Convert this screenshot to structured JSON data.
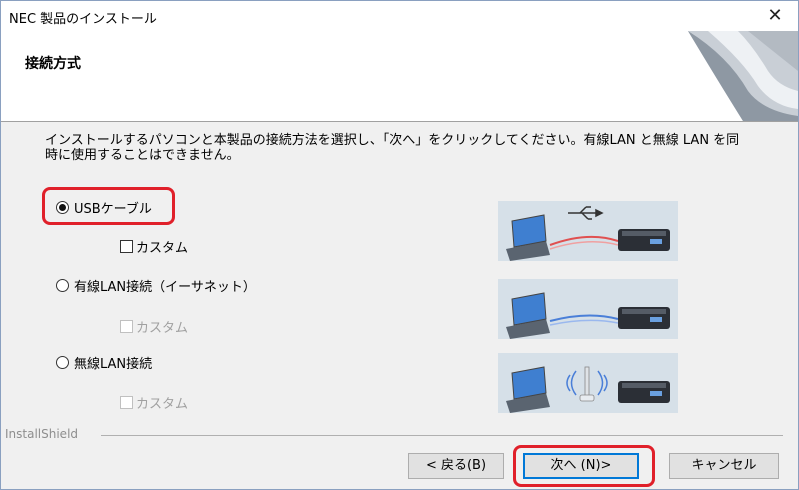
{
  "window": {
    "title": "NEC 製品のインストール",
    "close_glyph": "✕"
  },
  "header": {
    "title": "接続方式"
  },
  "instruction": "インストールするパソコンと本製品の接続方法を選択し、「次へ」をクリックしてください。有線LAN と無線 LAN を同時に使用することはできません。",
  "options": [
    {
      "label": "USBケーブル",
      "checked": true,
      "custom_label": "カスタム",
      "custom_enabled": true
    },
    {
      "label": "有線LAN接続（イーサネット）",
      "checked": false,
      "custom_label": "カスタム",
      "custom_enabled": false
    },
    {
      "label": "無線LAN接続",
      "checked": false,
      "custom_label": "カスタム",
      "custom_enabled": false
    }
  ],
  "footer": {
    "brand": "InstallShield"
  },
  "buttons": {
    "back": "< 戻る(B)",
    "next": "次へ (N)>",
    "cancel": "キャンセル"
  },
  "colors": {
    "highlight": "#e0202a",
    "usb_link": "#e05050",
    "lan_link": "#4a7fd8"
  }
}
